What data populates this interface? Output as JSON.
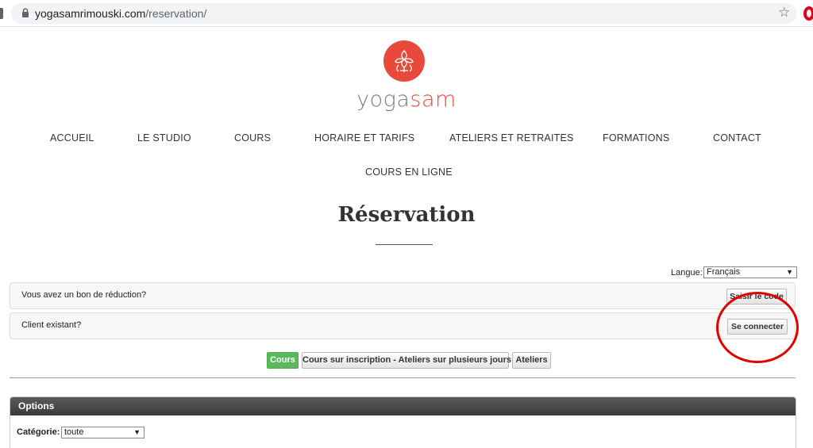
{
  "browser": {
    "url_domain": "yogasamrimouski.com",
    "url_path": "/reservation/"
  },
  "brand": {
    "part1": "yoga",
    "part2": "sam",
    "accent_color": "#e8493b"
  },
  "nav": {
    "accueil": "ACCUEIL",
    "studio": "LE STUDIO",
    "cours": "COURS",
    "horaire": "HORAIRE ET TARIFS",
    "ateliers": "ATELIERS ET RETRAITES",
    "formations": "FORMATIONS",
    "contact": "CONTACT",
    "en_ligne": "COURS EN LIGNE"
  },
  "page": {
    "title": "Réservation"
  },
  "language": {
    "label": "Langue:",
    "selected": "Français"
  },
  "panels": {
    "coupon": {
      "text": "Vous avez un bon de réduction?",
      "button": "Saisir le code"
    },
    "client": {
      "text": "Client existant?",
      "button": "Se connecter"
    }
  },
  "tabs": {
    "cours": "Cours",
    "inscription": "Cours sur inscription - Ateliers sur plusieurs jours",
    "ateliers": "Ateliers",
    "active_color": "#5cb85c"
  },
  "options": {
    "title": "Options",
    "category_label": "Catégorie:",
    "category_value": "toute"
  },
  "annotation": {
    "color": "#e30000"
  }
}
